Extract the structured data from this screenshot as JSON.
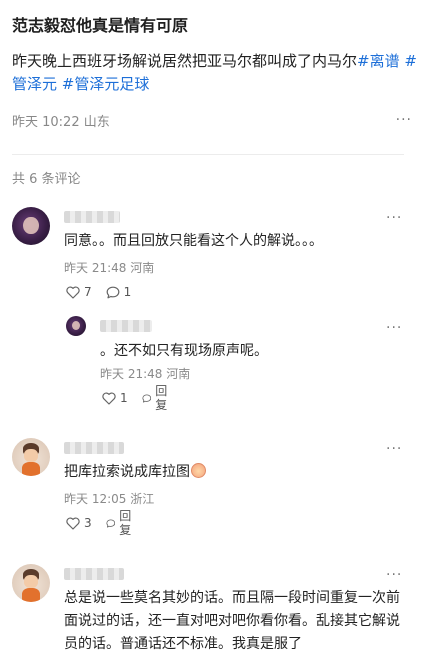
{
  "post": {
    "title": "范志毅怼他真是情有可原",
    "body_text": "昨天晚上西班牙场解说居然把亚马尔都叫成了内马尔",
    "tags": [
      "#离谱",
      "#管泽元",
      "#管泽元足球"
    ],
    "time_location": "昨天 10:22 山东",
    "more": "···"
  },
  "comments_count": "共 6 条评论",
  "comments": [
    {
      "text": "同意。。而且回放只能看这个人的解说。。。",
      "meta": "昨天 21:48 河南",
      "likes": "7",
      "reply_count": "1",
      "more": "···"
    },
    {
      "text": "。还不如只有现场原声呢。",
      "meta": "昨天 21:48 河南",
      "likes": "1",
      "reply_label": "回复",
      "more": "···"
    },
    {
      "text": "把库拉索说成库拉图",
      "meta": "昨天 12:05 浙江",
      "likes": "3",
      "reply_label": "回复",
      "more": "···"
    },
    {
      "text": "总是说一些莫名其妙的话。而且隔一段时间重复一次前面说过的话，还一直对吧对吧你看你看。乱接其它解说员的话。普通话还不标准。我真是服了",
      "more": "···"
    }
  ]
}
